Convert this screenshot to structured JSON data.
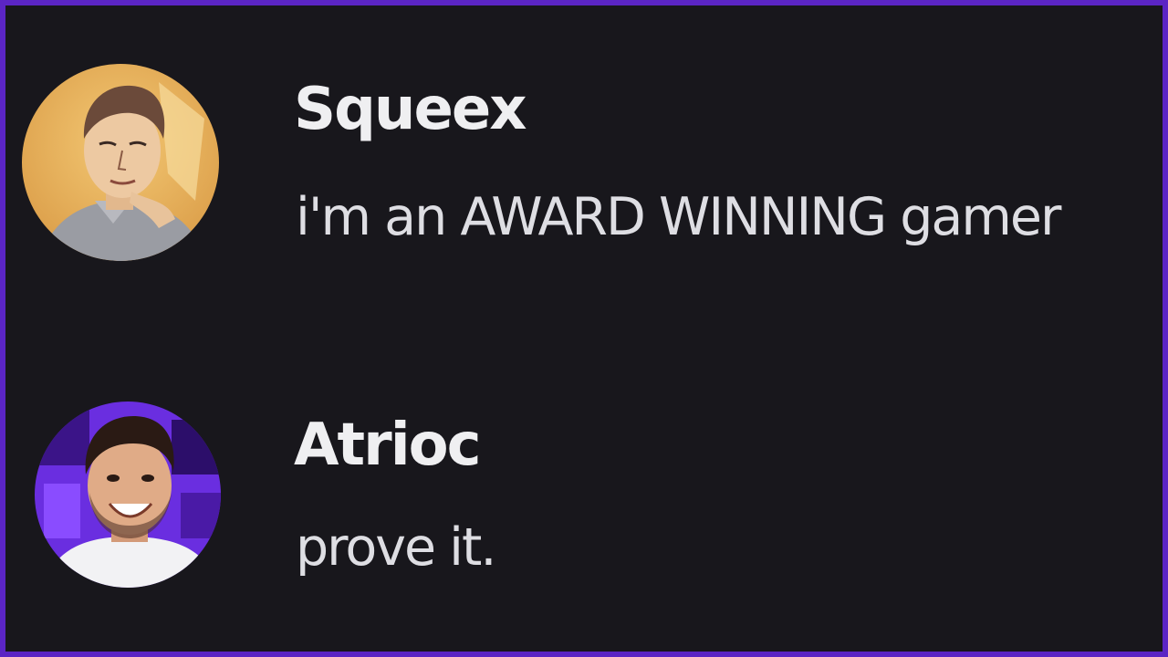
{
  "theme": {
    "border_color": "#5b25c4",
    "background": "#18171c",
    "username_color": "#efeff1",
    "text_color": "#dedee3"
  },
  "messages": [
    {
      "username": "Squeex",
      "text": "i'm an AWARD WINNING gamer",
      "avatar_icon": "illustrated-man-avatar"
    },
    {
      "username": "Atrioc",
      "text": "prove it.",
      "avatar_icon": "smiling-man-photo-avatar"
    }
  ]
}
